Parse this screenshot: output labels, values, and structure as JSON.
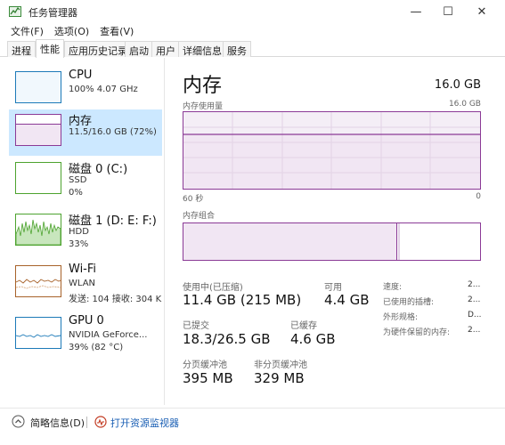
{
  "window": {
    "title": "任务管理器",
    "controls": {
      "minimize": "—",
      "maximize": "☐",
      "close": "✕"
    }
  },
  "menu": [
    "文件(F)",
    "选项(O)",
    "查看(V)"
  ],
  "tabs": [
    "进程",
    "性能",
    "应用历史记录",
    "启动",
    "用户",
    "详细信息",
    "服务"
  ],
  "active_tab": "性能",
  "sidebar": {
    "items": [
      {
        "title": "CPU",
        "sub1": "100% 4.07 GHz",
        "sub2": "",
        "color": "#1c7ab8"
      },
      {
        "title": "内存",
        "sub1": "11.5/16.0 GB (72%)",
        "sub2": "",
        "color": "#8b3a96"
      },
      {
        "title": "磁盘 0 (C:)",
        "sub1": "SSD",
        "sub2": "0%",
        "color": "#4da32f"
      },
      {
        "title": "磁盘 1 (D: E: F:)",
        "sub1": "HDD",
        "sub2": "33%",
        "color": "#4da32f"
      },
      {
        "title": "Wi-Fi",
        "sub1": "WLAN",
        "sub2": "发送: 104 接收: 304 K",
        "color": "#a7622a"
      },
      {
        "title": "GPU 0",
        "sub1": "NVIDIA GeForce...",
        "sub2": "39% (82 °C)",
        "color": "#1c7ab8"
      }
    ],
    "selected": 1
  },
  "main": {
    "title": "内存",
    "total": "16.0 GB",
    "graph_label": "内存使用量",
    "graph_max": "16.0 GB",
    "graph_time": "60 秒",
    "graph_zero": "0",
    "composition_label": "内存组合",
    "stats": {
      "in_use_label": "使用中(已压缩)",
      "in_use_value": "11.4 GB (215 MB)",
      "available_label": "可用",
      "available_value": "4.4 GB",
      "committed_label": "已提交",
      "committed_value": "18.3/26.5 GB",
      "cached_label": "已缓存",
      "cached_value": "4.6 GB",
      "paged_label": "分页缓冲池",
      "paged_value": "395 MB",
      "nonpaged_label": "非分页缓冲池",
      "nonpaged_value": "329 MB"
    },
    "specs": [
      {
        "label": "速度:",
        "value": "2..."
      },
      {
        "label": "已使用的插槽:",
        "value": "2..."
      },
      {
        "label": "外形规格:",
        "value": "D..."
      },
      {
        "label": "为硬件保留的内存:",
        "value": "2..."
      }
    ]
  },
  "footer": {
    "brief": "简略信息(D)",
    "resmon": "打开资源监视器"
  }
}
